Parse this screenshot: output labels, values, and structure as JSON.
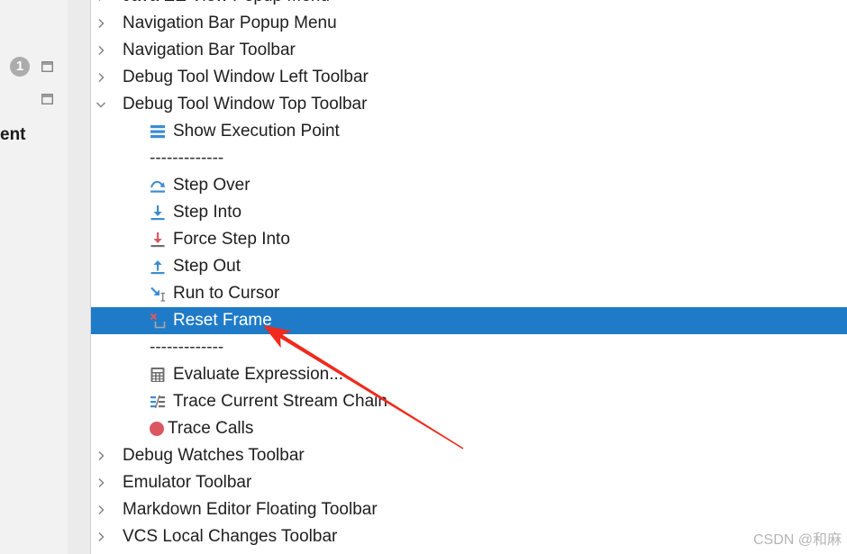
{
  "sidebar": {
    "notification_count": "1",
    "title_fragment": "ent",
    "button_icons": [
      "window-icon",
      "window-icon"
    ]
  },
  "tree": {
    "rows": [
      {
        "label": "Java EE View Popup Menu",
        "expanded": false
      },
      {
        "label": "Navigation Bar Popup Menu",
        "expanded": false
      },
      {
        "label": "Navigation Bar Toolbar",
        "expanded": false
      },
      {
        "label": "Debug Tool Window Left Toolbar",
        "expanded": false
      },
      {
        "label": "Debug Tool Window Top Toolbar",
        "expanded": true
      },
      {
        "label": "Show Execution Point",
        "icon": "show-execution-point-icon"
      },
      {
        "label": "-------------"
      },
      {
        "label": "Step Over",
        "icon": "step-over-icon"
      },
      {
        "label": "Step Into",
        "icon": "step-into-icon"
      },
      {
        "label": "Force Step Into",
        "icon": "force-step-into-icon"
      },
      {
        "label": "Step Out",
        "icon": "step-out-icon"
      },
      {
        "label": "Run to Cursor",
        "icon": "run-to-cursor-icon"
      },
      {
        "label": "Reset Frame",
        "icon": "reset-frame-icon",
        "selected": true
      },
      {
        "label": "-------------"
      },
      {
        "label": "Evaluate Expression...",
        "icon": "calculator-icon"
      },
      {
        "label": "Trace Current Stream Chain",
        "icon": "stream-chain-icon"
      },
      {
        "label": "Trace Calls",
        "icon": "record-icon"
      },
      {
        "label": "Debug Watches Toolbar",
        "expanded": false
      },
      {
        "label": "Emulator Toolbar",
        "expanded": false
      },
      {
        "label": "Markdown Editor Floating Toolbar",
        "expanded": false
      },
      {
        "label": "VCS Local Changes Toolbar",
        "expanded": false
      }
    ]
  },
  "watermark": "CSDN @和麻",
  "colors": {
    "selection": "#1f7bc8",
    "text": "#1e1e1e",
    "icon_blue": "#3c8cd2",
    "icon_red": "#db5860",
    "annotation_arrow": "#f02a1e",
    "watermark": "#b5b5b5",
    "sidebar_bg": "#f2f2f2",
    "strip_bg": "#ebebeb"
  }
}
